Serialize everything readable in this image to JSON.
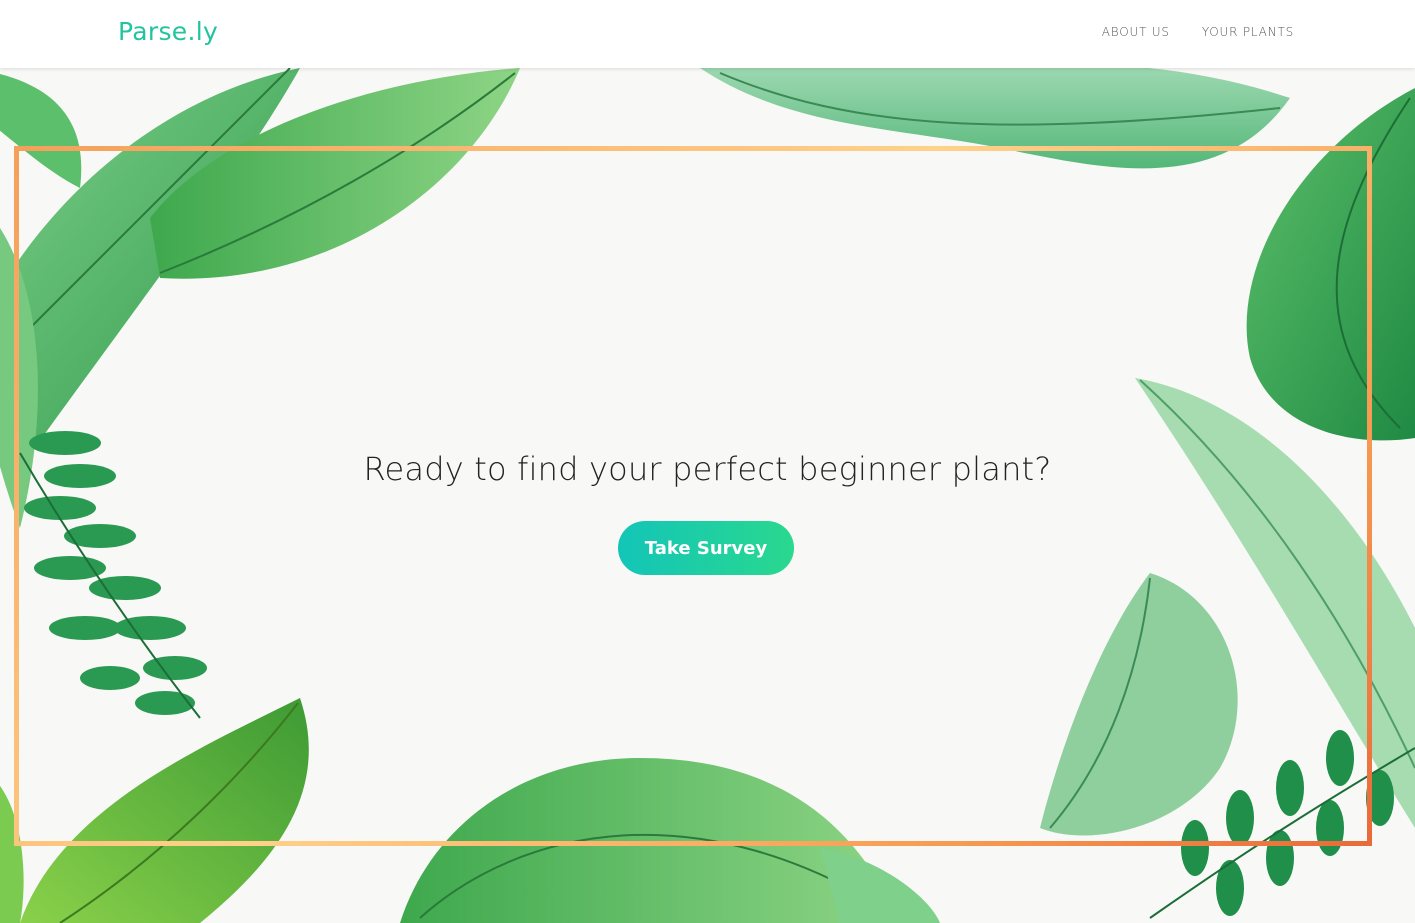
{
  "brand": {
    "name": "Parse.ly",
    "color": "#22c4a0"
  },
  "nav": {
    "items": [
      {
        "label": "ABOUT US"
      },
      {
        "label": "YOUR PLANTS"
      }
    ]
  },
  "hero": {
    "headline": "Ready to find your perfect beginner plant?",
    "cta_label": "Take Survey",
    "cta_gradient": [
      "#13c5b8",
      "#2ad88e"
    ],
    "frame_colors": [
      "#f4a05a",
      "#ffd18a",
      "#e96a3a"
    ]
  }
}
